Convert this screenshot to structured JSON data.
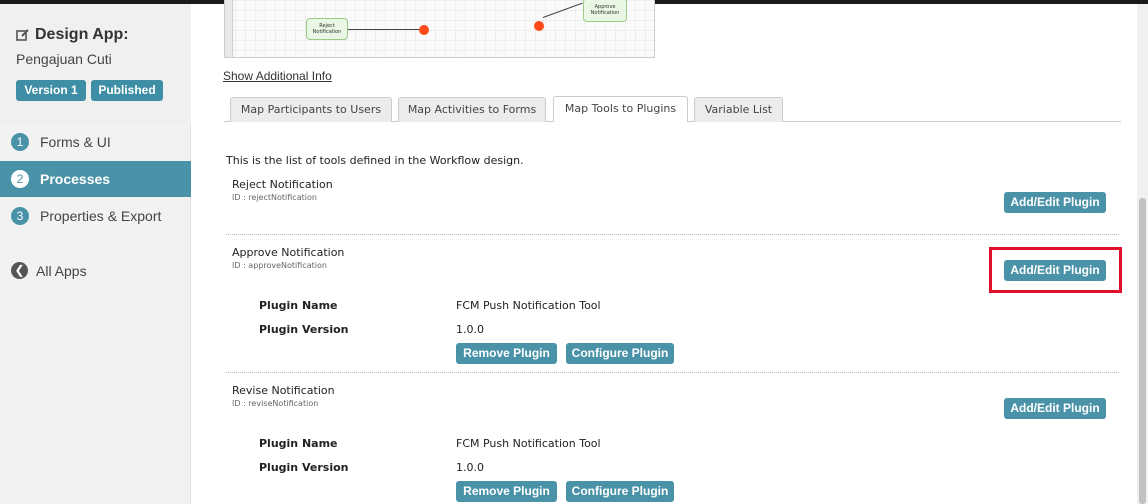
{
  "sidebar": {
    "app_title": "Design App:",
    "app_name": "Pengajuan Cuti",
    "version_badge": "Version 1",
    "status_badge": "Published",
    "nav": [
      {
        "num": "1",
        "label": "Forms & UI"
      },
      {
        "num": "2",
        "label": "Processes"
      },
      {
        "num": "3",
        "label": "Properties & Export"
      }
    ],
    "all_apps": "All Apps"
  },
  "diagram": {
    "reject_node": "Reject Notification",
    "approve_node": "Approve Notification"
  },
  "show_info_link": "Show Additional Info",
  "tabs": [
    {
      "label": "Map Participants to Users"
    },
    {
      "label": "Map Activities to Forms"
    },
    {
      "label": "Map Tools to Plugins"
    },
    {
      "label": "Variable List"
    }
  ],
  "intro": "This is the list of tools defined in the Workflow design.",
  "plugin_name_label": "Plugin Name",
  "plugin_version_label": "Plugin Version",
  "add_edit_label": "Add/Edit Plugin",
  "remove_label": "Remove Plugin",
  "configure_label": "Configure Plugin",
  "tools": [
    {
      "name": "Reject Notification",
      "id": "ID : rejectNotification"
    },
    {
      "name": "Approve Notification",
      "id": "ID : approveNotification",
      "plugin_name": "FCM Push Notification Tool",
      "plugin_version": "1.0.0"
    },
    {
      "name": "Revise Notification",
      "id": "ID : reviseNotification",
      "plugin_name": "FCM Push Notification Tool",
      "plugin_version": "1.0.0"
    }
  ],
  "colors": {
    "accent": "#4a92a8",
    "highlight": "#e0102a",
    "end_event": "#ff4a1a"
  }
}
